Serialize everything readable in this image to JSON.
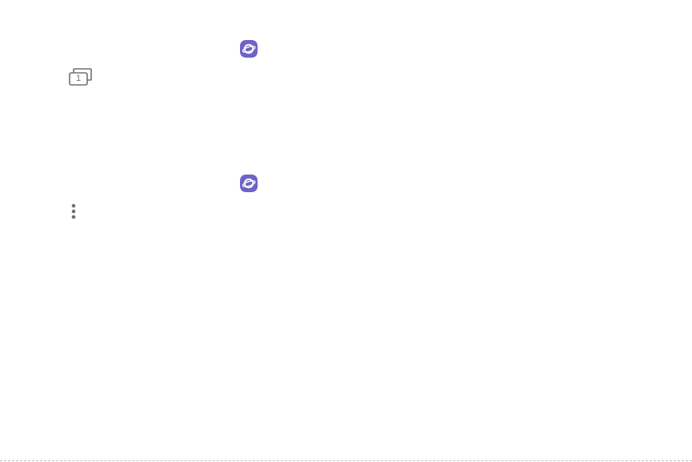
{
  "icons": {
    "internet_app_first": "samsung-internet-icon",
    "tabs_button": "tabs-icon",
    "internet_app_second": "samsung-internet-icon",
    "more_options": "more-options-icon"
  },
  "tabs_button": {
    "count": "1"
  },
  "colors": {
    "internet_icon_bg": "#6F63C7",
    "icon_gray": "#707070"
  }
}
